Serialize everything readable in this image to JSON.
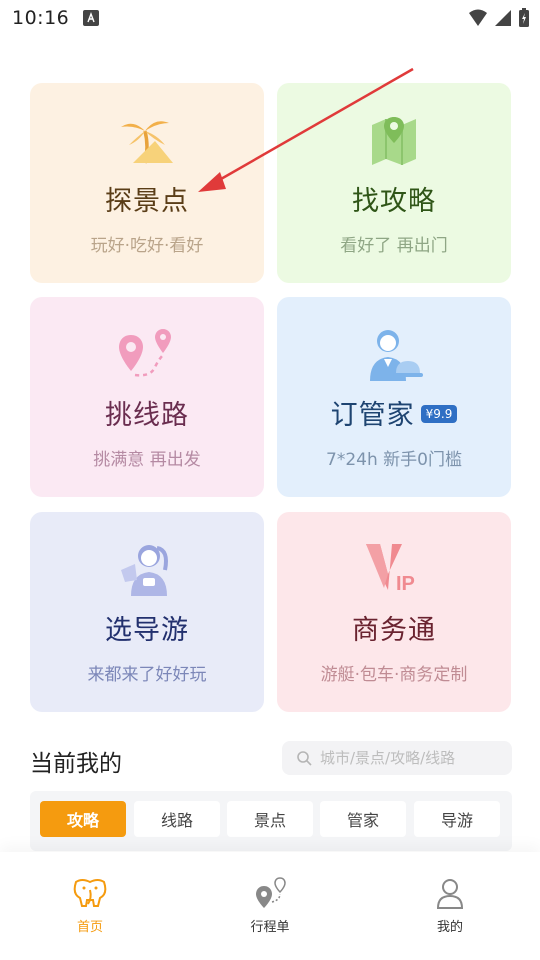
{
  "status_bar": {
    "time": "10:16"
  },
  "cards": [
    {
      "title": "探景点",
      "subtitle": "玩好·吃好·看好",
      "icon": "palm-beach-icon"
    },
    {
      "title": "找攻略",
      "subtitle": "看好了 再出门",
      "icon": "map-pin-icon"
    },
    {
      "title": "挑线路",
      "subtitle": "挑满意 再出发",
      "icon": "route-icon"
    },
    {
      "title": "订管家",
      "badge": "¥9.9",
      "subtitle": "7*24h 新手0门槛",
      "icon": "butler-icon"
    },
    {
      "title": "选导游",
      "subtitle": "来都来了好好玩",
      "icon": "tour-guide-icon"
    },
    {
      "title": "商务通",
      "subtitle": "游艇·包车·商务定制",
      "icon": "vip-icon"
    }
  ],
  "section": {
    "title": "当前我的",
    "search_placeholder": "城市/景点/攻略/线路"
  },
  "tabs": [
    {
      "label": "攻略",
      "active": true
    },
    {
      "label": "线路",
      "active": false
    },
    {
      "label": "景点",
      "active": false
    },
    {
      "label": "管家",
      "active": false
    },
    {
      "label": "导游",
      "active": false
    }
  ],
  "bottom_nav": [
    {
      "label": "首页",
      "active": true,
      "icon": "elephant-home-icon"
    },
    {
      "label": "行程单",
      "active": false,
      "icon": "itinerary-icon"
    },
    {
      "label": "我的",
      "active": false,
      "icon": "user-icon"
    }
  ],
  "colors": {
    "accent": "#f59b0f",
    "annotation_arrow": "#e03a3a"
  }
}
